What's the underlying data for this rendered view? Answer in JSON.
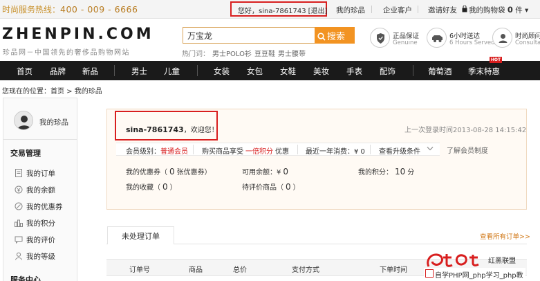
{
  "topbar": {
    "hotline_label": "时尚服务热线：",
    "hotline_number": "400 - 009 - 6666",
    "greeting": "您好，sina-7861743",
    "logout": "[退出]",
    "links": [
      "我的珍品",
      "企业客户",
      "邀请好友"
    ],
    "cart_label": "我的购物袋",
    "cart_count": "0",
    "cart_unit": "件",
    "cart_arrow": "▾"
  },
  "header": {
    "logo": "ZHENPIN.COM",
    "slogan": "珍品网－中国领先的奢侈品购物网站",
    "search_value": "万宝龙",
    "search_button": "搜索",
    "hotwords_label": "热门词：",
    "hotwords": [
      "男士POLO衫",
      "豆豆鞋",
      "男士腰带"
    ],
    "services": [
      {
        "title": "正品保证",
        "sub": "Genuine",
        "icon": "shield-icon"
      },
      {
        "title": "6小时送达",
        "sub": "6 Hours Served",
        "icon": "car-icon"
      },
      {
        "title": "时尚顾问",
        "sub": "Consultant",
        "icon": "consultant-icon"
      }
    ]
  },
  "nav": {
    "items": [
      "首页",
      "品牌",
      "新品",
      "男士",
      "儿童",
      "女装",
      "女包",
      "女鞋",
      "美妆",
      "手表",
      "配饰",
      "葡萄酒",
      "季末特惠"
    ],
    "hot_badge": "HOT"
  },
  "breadcrumb": {
    "prefix": "您现在的位置：",
    "path": "首页 > 我的珍品"
  },
  "sidebar": {
    "profile_label": "我的珍品",
    "section_trade": "交易管理",
    "items": [
      {
        "label": "我的订单",
        "icon": "order-icon"
      },
      {
        "label": "我的余额",
        "icon": "balance-icon"
      },
      {
        "label": "我的优惠券",
        "icon": "coupon-icon"
      },
      {
        "label": "我的积分",
        "icon": "points-icon"
      },
      {
        "label": "我的评价",
        "icon": "review-icon"
      },
      {
        "label": "我的等级",
        "icon": "level-icon"
      }
    ],
    "section_service": "服务中心"
  },
  "account": {
    "username": "sina-7861743",
    "welcome": "，欢迎您！",
    "last_login": "上一次登录时间2013-08-28 14:15:42",
    "level_label": "会员级别：",
    "level_value": "普通会员",
    "discount_label": "购买商品享受",
    "discount_value": "一倍积分",
    "discount_suffix": "优惠",
    "yearly_label": "最近一年消费：¥ 0",
    "upgrade_label": "查看升级条件",
    "know_level": "了解会员制度",
    "coupon_label": "我的优惠券（",
    "coupon_value": "0",
    "coupon_suffix": "张优惠券）",
    "balance_label": "可用余额：¥",
    "balance_value": "0",
    "points_label": "我的积分：",
    "points_value": "10",
    "points_unit": "分",
    "fav_label": "我的收藏（",
    "fav_value": "0",
    "fav_suffix": "）",
    "pending_label": "待评价商品（",
    "pending_value": "0",
    "pending_suffix": "）"
  },
  "orders": {
    "tab": "未处理订单",
    "view_all": "查看所有订单>>",
    "columns": [
      "订单号",
      "商品",
      "总价",
      "支付方式",
      "下单时间"
    ]
  },
  "watermark": {
    "brand": "红黑联盟",
    "text": "自学PHP网_php学习_php教"
  },
  "colors": {
    "accent_orange": "#f29322",
    "highlight_red": "#d81e1e",
    "nav_bg": "#1a1a1a"
  }
}
